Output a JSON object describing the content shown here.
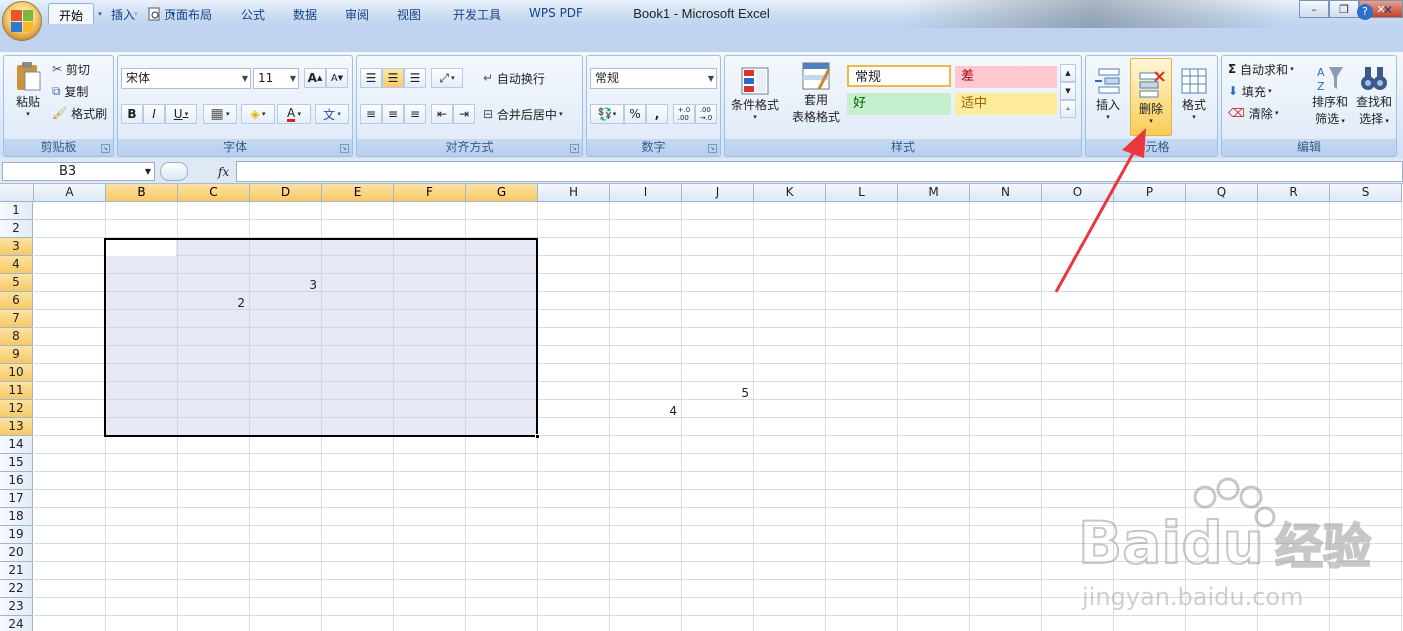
{
  "window": {
    "title": "Book1 - Microsoft Excel"
  },
  "tabs": [
    "开始",
    "插入",
    "页面布局",
    "公式",
    "数据",
    "审阅",
    "视图",
    "开发工具",
    "WPS PDF"
  ],
  "active_tab": "开始",
  "clipboard": {
    "paste": "粘贴",
    "cut": "剪切",
    "copy": "复制",
    "format_painter": "格式刷",
    "label": "剪贴板"
  },
  "font": {
    "name": "宋体",
    "size": "11",
    "label": "字体",
    "bold": "B",
    "italic": "I",
    "underline": "U",
    "grow": "A",
    "shrink": "A",
    "font_color_letter": "A",
    "phonetic": "文"
  },
  "alignment": {
    "wrap": "自动换行",
    "merge": "合并后居中",
    "label": "对齐方式"
  },
  "number": {
    "format": "常规",
    "percent": "%",
    "comma": ",",
    "inc_decimal": "+.0\n.00",
    "dec_decimal": ".00\n→.0",
    "label": "数字"
  },
  "styles": {
    "conditional": "条件格式",
    "table_format_1": "套用",
    "table_format_2": "表格格式",
    "normal": "常规",
    "bad": "差",
    "good": "好",
    "neutral": "适中",
    "label": "样式",
    "colors": {
      "normal_bg": "#ffffff",
      "bad_bg": "#ffc7ce",
      "bad_fg": "#9c0006",
      "good_bg": "#c6efce",
      "good_fg": "#006100",
      "neutral_bg": "#ffeb9c",
      "neutral_fg": "#9c6500"
    }
  },
  "cells": {
    "insert": "插入",
    "delete": "删除",
    "format": "格式",
    "label": "单元格"
  },
  "editing": {
    "autosum": "自动求和",
    "fill": "填充",
    "clear": "清除",
    "sort_1": "排序和",
    "sort_2": "筛选",
    "find_1": "查找和",
    "find_2": "选择",
    "label": "编辑"
  },
  "formula_bar": {
    "name_box": "B3",
    "fx": "fx",
    "value": ""
  },
  "columns": [
    "A",
    "B",
    "C",
    "D",
    "E",
    "F",
    "G",
    "H",
    "I",
    "J",
    "K",
    "L",
    "M",
    "N",
    "O",
    "P",
    "Q",
    "R",
    "S"
  ],
  "selected_columns": [
    "B",
    "C",
    "D",
    "E",
    "F",
    "G"
  ],
  "rows": [
    "1",
    "2",
    "3",
    "4",
    "5",
    "6",
    "7",
    "8",
    "9",
    "10",
    "11",
    "12",
    "13",
    "14",
    "15",
    "16",
    "17",
    "18",
    "19",
    "20",
    "21",
    "22",
    "23",
    "24"
  ],
  "selected_rows": [
    "3",
    "4",
    "5",
    "6",
    "7",
    "8",
    "9",
    "10",
    "11",
    "12",
    "13"
  ],
  "cell_values": {
    "D5": "3",
    "C6": "2",
    "J11": "5",
    "I12": "4"
  },
  "selection": "B3:G13",
  "annotation": {
    "arrow_color": "#e8383d",
    "target": "删除"
  },
  "watermark": {
    "brand": "Baidu",
    "cn": "经验",
    "url": "jingyan.baidu.com"
  },
  "accent": "#2b579a"
}
